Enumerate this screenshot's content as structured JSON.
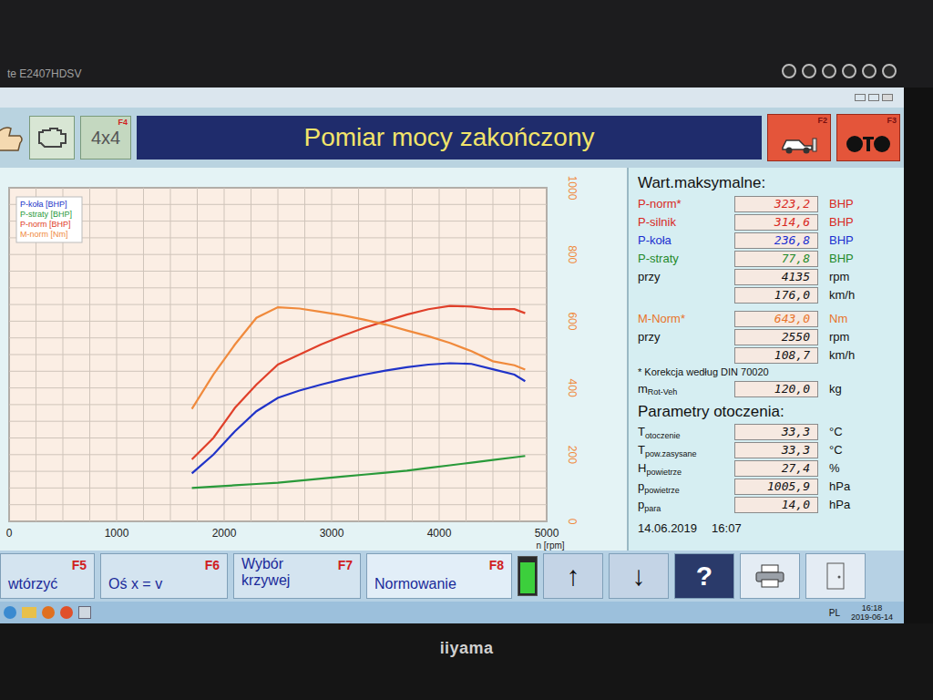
{
  "monitor": {
    "model": "te E2407HDSV",
    "brand": "iiyama"
  },
  "header": {
    "title": "Pomiar mocy zakończony",
    "left_buttons": [
      {
        "kind": "thumb",
        "label": "",
        "key": ""
      },
      {
        "kind": "engine",
        "label": "",
        "key": ""
      },
      {
        "kind": "text",
        "label": "4x4",
        "key": "F4"
      }
    ],
    "right_buttons": [
      {
        "kind": "car",
        "key": "F2"
      },
      {
        "kind": "rollers",
        "key": "F3"
      }
    ]
  },
  "chart": {
    "x_ticks": [
      "0",
      "1000",
      "2000",
      "3000",
      "4000",
      "5000"
    ],
    "x_label": "n [rpm]",
    "y_ticks": [
      "0",
      "200",
      "400",
      "600",
      "800",
      "1000"
    ],
    "rpm": [
      1700,
      1900,
      2100,
      2300,
      2500,
      2700,
      2900,
      3100,
      3300,
      3500,
      3700,
      3900,
      4100,
      4300,
      4500,
      4700,
      4800
    ],
    "series": [
      {
        "legend": "P-koła [BHP]",
        "axis": "power",
        "color": "#2033c8",
        "values": [
          72,
          100,
          135,
          165,
          185,
          196,
          205,
          213,
          220,
          226,
          231,
          235,
          237,
          236,
          228,
          220,
          210
        ]
      },
      {
        "legend": "P-straty [BHP]",
        "axis": "power",
        "color": "#2a9a3a",
        "values": [
          50,
          52,
          54,
          56,
          58,
          61,
          64,
          67,
          70,
          73,
          76,
          80,
          84,
          88,
          92,
          96,
          98
        ]
      },
      {
        "legend": "P-norm [BHP]",
        "axis": "power",
        "color": "#e0402a",
        "values": [
          93,
          125,
          170,
          205,
          235,
          250,
          265,
          278,
          290,
          300,
          310,
          318,
          323,
          322,
          318,
          318,
          312
        ]
      },
      {
        "legend": "M-norm [Nm]",
        "axis": "torque",
        "color": "#f08a3c",
        "values": [
          337,
          440,
          530,
          610,
          642,
          638,
          628,
          618,
          605,
          590,
          572,
          555,
          535,
          510,
          480,
          468,
          455
        ]
      }
    ]
  },
  "max_panel": {
    "title": "Wart.maksymalne:",
    "power_rows": [
      {
        "label": "P-norm*",
        "sub": "",
        "value": "323,2",
        "unit": "BHP",
        "color": "#d8281e"
      },
      {
        "label": "P-silnik",
        "sub": "",
        "value": "314,6",
        "unit": "BHP",
        "color": "#d8281e"
      },
      {
        "label": "P-koła",
        "sub": "",
        "value": "236,8",
        "unit": "BHP",
        "color": "#1a2fd0"
      },
      {
        "label": "P-straty",
        "sub": "",
        "value": "77,8",
        "unit": "BHP",
        "color": "#1f8a2a"
      },
      {
        "label": "przy",
        "sub": "",
        "value": "4135",
        "unit": "rpm",
        "color": "#111111"
      },
      {
        "label": "",
        "sub": "",
        "value": "176,0",
        "unit": "km/h",
        "color": "#111111"
      }
    ],
    "torque_rows": [
      {
        "label": "M-Norm*",
        "sub": "",
        "value": "643,0",
        "unit": "Nm",
        "color": "#e8742a"
      },
      {
        "label": "przy",
        "sub": "",
        "value": "2550",
        "unit": "rpm",
        "color": "#111111"
      },
      {
        "label": "",
        "sub": "",
        "value": "108,7",
        "unit": "km/h",
        "color": "#111111"
      }
    ],
    "note": "* Korekcja według DIN 70020",
    "mass_row": {
      "label": "m",
      "sub": "Rot-Veh",
      "value": "120,0",
      "unit": "kg",
      "color": "#111111"
    },
    "ambient_title": "Parametry otoczenia:",
    "ambient_rows": [
      {
        "label": "T",
        "sub": "otoczenie",
        "value": "33,3",
        "unit": "°C",
        "color": "#111111"
      },
      {
        "label": "T",
        "sub": "pow.zasysane",
        "value": "33,3",
        "unit": "°C",
        "color": "#111111"
      },
      {
        "label": "H",
        "sub": "powietrze",
        "value": "27,4",
        "unit": "%",
        "color": "#111111"
      },
      {
        "label": "p",
        "sub": "powietrze",
        "value": "1005,9",
        "unit": "hPa",
        "color": "#111111"
      },
      {
        "label": "p",
        "sub": "para",
        "value": "14,0",
        "unit": "hPa",
        "color": "#111111"
      }
    ],
    "date": "14.06.2019",
    "time": "16:07"
  },
  "buttons": [
    {
      "lines": [
        "wtórzyć"
      ],
      "key": "F5"
    },
    {
      "lines": [
        "Oś x = v"
      ],
      "key": "F6"
    },
    {
      "lines": [
        "Wybór",
        "krzywej"
      ],
      "key": "F7"
    },
    {
      "lines": [
        "Normowanie"
      ],
      "key": "F8"
    }
  ],
  "indicator": {
    "level": 0.9
  },
  "tool_buttons": [
    {
      "kind": "up",
      "label": "↑"
    },
    {
      "kind": "down",
      "label": "↓"
    },
    {
      "kind": "help",
      "label": "?"
    },
    {
      "kind": "printer",
      "label": ""
    },
    {
      "kind": "exit",
      "label": ""
    }
  ],
  "taskbar": {
    "language": "PL",
    "time": "16:18",
    "date": "2019-06-14"
  }
}
